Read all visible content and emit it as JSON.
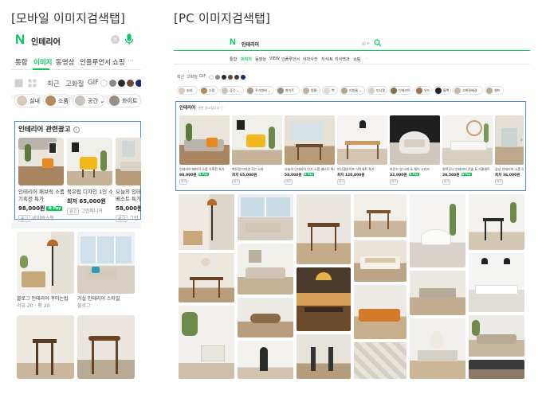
{
  "sections": {
    "mobile_title": "[모바일 이미지검색탭]",
    "pc_title": "[PC 이미지검색탭]"
  },
  "colors": {
    "naver_green": "#03c75a",
    "ad_border": "#4a90d9"
  },
  "mobile": {
    "logo": "N",
    "query": "인테리어",
    "clear_icon": "×",
    "tabs": [
      {
        "label": "통합"
      },
      {
        "label": "이미지"
      },
      {
        "label": "동영상"
      },
      {
        "label": "인플루언서"
      },
      {
        "label": "쇼핑"
      },
      {
        "label": "···"
      }
    ],
    "filters": {
      "latest": "최근",
      "hires": "고화질",
      "gif": "GIF"
    },
    "swatches": [
      "#ffffff",
      "#8a8a8a",
      "#2b2b2b",
      "#6b4a2f",
      "#4a3a2a",
      "#1a2a6b"
    ],
    "chips": [
      {
        "label": "실내"
      },
      {
        "label": "소품"
      },
      {
        "label": "공간 ⌄"
      },
      {
        "label": "화이트"
      }
    ],
    "ad": {
      "title": "인테리어 관련광고",
      "info_icon": "i",
      "cards": [
        {
          "title": "인테리어 패브릭 소품",
          "title2": "기획전 특가",
          "price": "98,000원",
          "pay": "N Pay",
          "ad_tag": "광고",
          "seller": "네이버쇼핑"
        },
        {
          "title": "북유럽 디자인 1인 소파",
          "title2": "최저 65,000원",
          "price": "",
          "pay": "",
          "ad_tag": "광고",
          "seller": "그린퍼니처"
        },
        {
          "title": "오늘의 인테리어",
          "title2": "베스트 특가",
          "price": "58,000원",
          "pay": "",
          "ad_tag": "광고",
          "seller": "그린"
        }
      ]
    },
    "grid": [
      {
        "caption": "블로그 인테리어 꾸미는법",
        "meta": "리뷰 20 · 평 20"
      },
      {
        "caption": "거실 인테리어 스타일",
        "meta": "블로그"
      }
    ]
  },
  "pc": {
    "logo": "N",
    "query": "인테리어",
    "kbd": "▤ ▾",
    "tabs": [
      {
        "label": "통합"
      },
      {
        "label": "이미지"
      },
      {
        "label": "동영상"
      },
      {
        "label": "VIEW"
      },
      {
        "label": "인플루언서"
      },
      {
        "label": "어학사전"
      },
      {
        "label": "지식iN"
      },
      {
        "label": "지식백과"
      },
      {
        "label": "쇼핑"
      },
      {
        "label": "···"
      }
    ],
    "filters": {
      "latest": "최근",
      "hires": "고화질",
      "gif": "GIF"
    },
    "swatches": [
      "#ffffff",
      "#8a8a8a",
      "#2b2b2b",
      "#6b4a2f",
      "#4a3a2a",
      "#1a2a6b"
    ],
    "chips": [
      {
        "label": "실내"
      },
      {
        "label": "소품"
      },
      {
        "label": "공간 ⌄"
      },
      {
        "label": "주거형태 ⌄"
      },
      {
        "label": "화이트"
      },
      {
        "label": "원룸"
      },
      {
        "label": "벽"
      },
      {
        "label": "리빙룸 ⌄"
      },
      {
        "label": "미니멀"
      },
      {
        "label": "인테리어"
      },
      {
        "label": "우드"
      },
      {
        "label": "블랙"
      },
      {
        "label": "고화질배경"
      },
      {
        "label": "셀프"
      }
    ],
    "ad": {
      "title": "인테리어",
      "sub": "관련 광고입니다 ⓘ",
      "next_icon": "›",
      "cards": [
        {
          "title": "인테리어 패브릭 소품 기획전 특가",
          "price": "98,000원",
          "pay": "N Pay",
          "ad_tag": "광고"
        },
        {
          "title": "북유럽 디자인 1인 소파",
          "price": "최저 65,000원",
          "pay": "",
          "ad_tag": "광고"
        },
        {
          "title": "오늘의 인테리어 인기 소품 베스트 특가",
          "price": "58,000원",
          "pay": "N Pay",
          "ad_tag": "광고"
        },
        {
          "title": "미니멀라이프 식탁세트 특가",
          "price": "최저 120,000원",
          "pay": "",
          "ad_tag": "광고"
        },
        {
          "title": "라운드 암 소파 & 체어 시리즈",
          "price": "32,000원",
          "pay": "N Pay",
          "ad_tag": "광고"
        },
        {
          "title": "원목무늬 인테리어 콘솔 & 거울세트",
          "price": "28,500원",
          "pay": "N Pay",
          "ad_tag": "광고"
        },
        {
          "title": "감성 인테리어 소품 모음",
          "price": "최저 36,000원",
          "pay": "",
          "ad_tag": "광고"
        }
      ]
    }
  }
}
